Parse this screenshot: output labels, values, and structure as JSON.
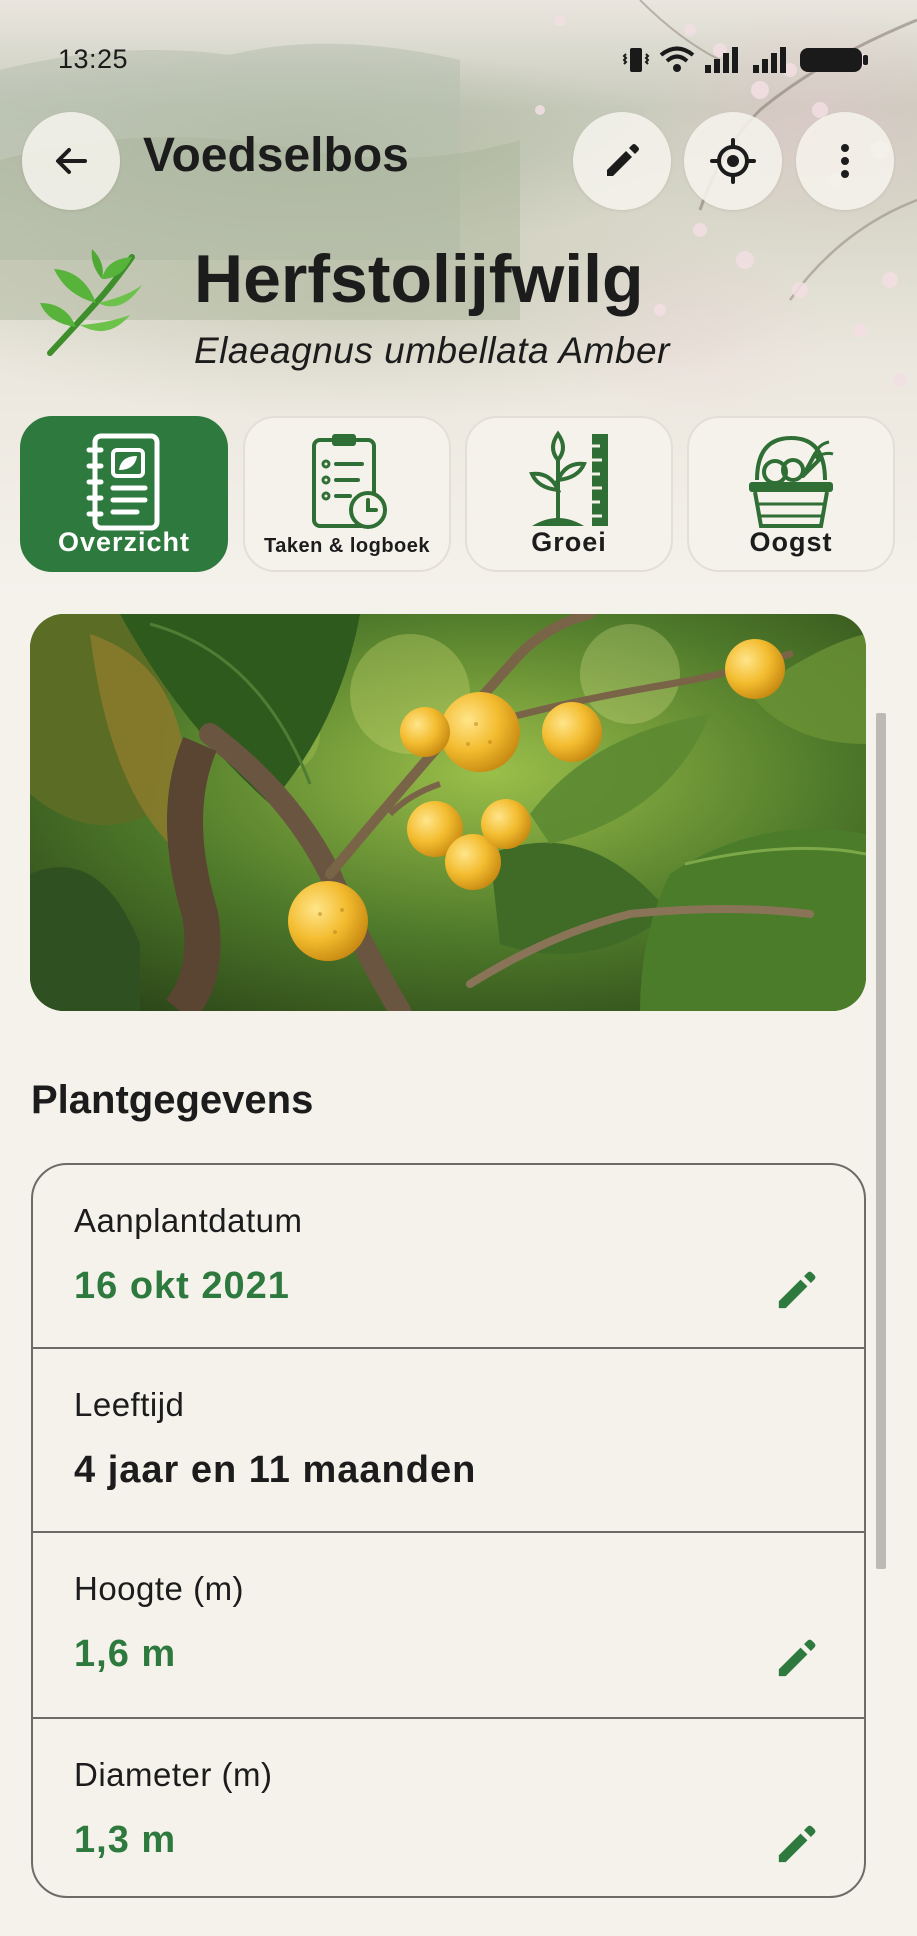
{
  "status_bar": {
    "time": "13:25",
    "icons": [
      "vibrate-icon",
      "wifi-icon",
      "signal-icon",
      "signal-icon",
      "battery-icon"
    ]
  },
  "app_bar": {
    "title": "Voedselbos",
    "back_icon": "arrow-left-icon",
    "actions": [
      "pencil-icon",
      "crosshair-icon",
      "more-vertical-icon"
    ]
  },
  "plant": {
    "name": "Herfstolijfwilg",
    "latin_name": "Elaeagnus umbellata Amber",
    "icon": "leaf-sprig-icon"
  },
  "tabs": [
    {
      "label": "Overzicht",
      "icon": "notebook-leaf-icon",
      "active": true
    },
    {
      "label": "Taken & logboek",
      "icon": "clipboard-clock-icon",
      "active": false
    },
    {
      "label": "Groei",
      "icon": "sprout-ruler-icon",
      "active": false
    },
    {
      "label": "Oogst",
      "icon": "harvest-basket-icon",
      "active": false
    }
  ],
  "photo": {
    "subject": "berry-branch"
  },
  "details": {
    "section_title": "Plantgegevens",
    "rows": [
      {
        "label": "Aanplantdatum",
        "value": "16 okt 2021",
        "value_color": "#2e7a3e",
        "editable": true
      },
      {
        "label": "Leeftijd",
        "value": "4 jaar en 11 maanden",
        "value_color": "#1c1c1c",
        "editable": false
      },
      {
        "label": "Hoogte (m)",
        "value": "1,6 m",
        "value_color": "#2e7a3e",
        "editable": true
      },
      {
        "label": "Diameter (m)",
        "value": "1,3 m",
        "value_color": "#2e7a3e",
        "editable": true
      }
    ]
  },
  "colors": {
    "accent": "#2e7a3e",
    "background": "#f5f2ec",
    "text": "#1c1c1c"
  }
}
